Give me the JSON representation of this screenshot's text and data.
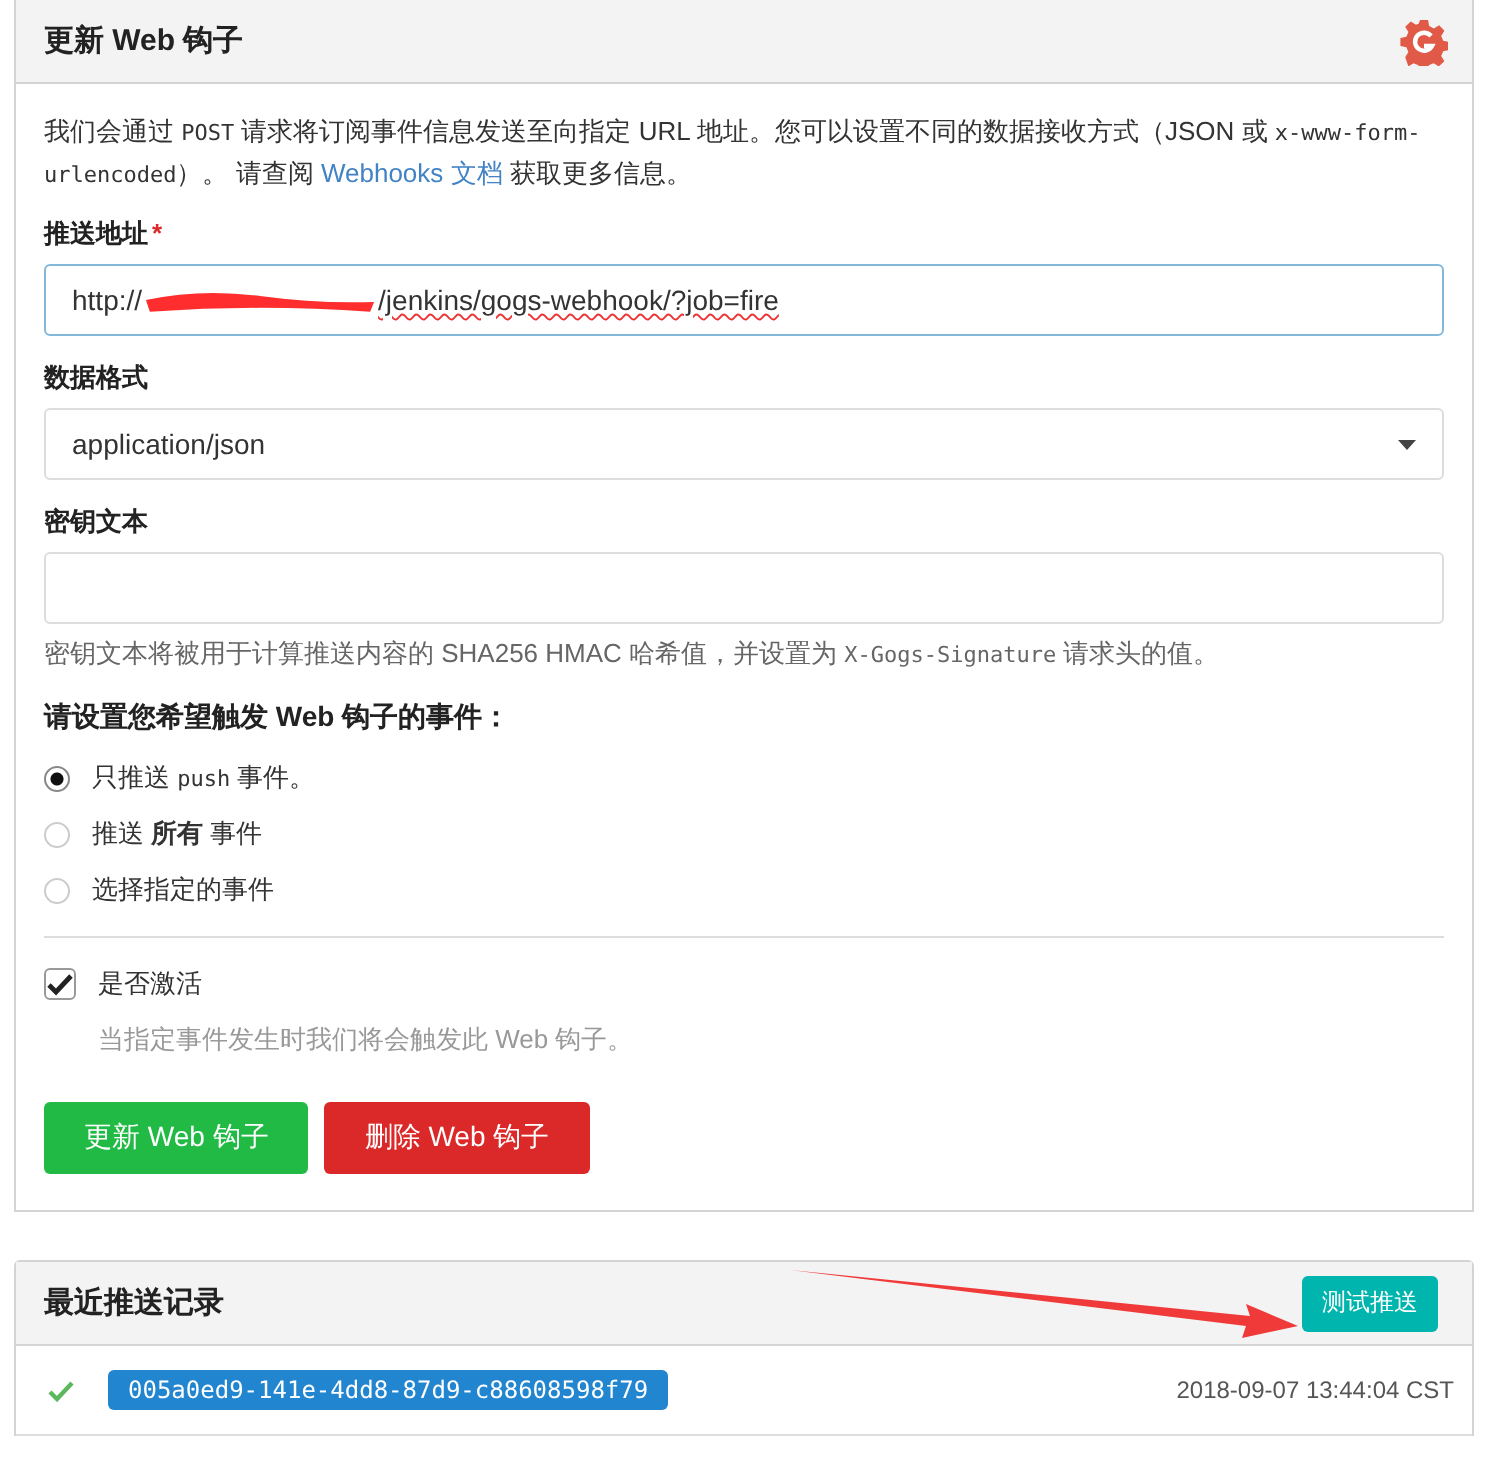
{
  "panel": {
    "title": "更新 Web 钩子",
    "description": [
      {
        "kind": "text",
        "text": "我们会通过 "
      },
      {
        "kind": "code",
        "text": "POST"
      },
      {
        "kind": "text",
        "text": " 请求将订阅事件信息发送至向指定 URL 地址。您可以设置不同的数据接收方式（JSON 或 "
      },
      {
        "kind": "code",
        "text": "x-www-form-urlencoded"
      },
      {
        "kind": "text",
        "text": "）。 请查阅 "
      },
      {
        "kind": "link",
        "text": "Webhooks 文档"
      },
      {
        "kind": "text",
        "text": " 获取更多信息。"
      }
    ],
    "url_field": {
      "label": "推送地址",
      "required_mark": "*",
      "value_start": "http://",
      "value_end": "/jenkins/gogs-webhook/?job=fire",
      "redacted": true
    },
    "format_field": {
      "label": "数据格式",
      "value": "application/json"
    },
    "secret_field": {
      "label": "密钥文本",
      "help": [
        {
          "kind": "text",
          "text": "密钥文本将被用于计算推送内容的 SHA256 HMAC 哈希值，并设置为 "
        },
        {
          "kind": "code",
          "text": "X-Gogs-Signature"
        },
        {
          "kind": "text",
          "text": " 请求头的值。"
        }
      ]
    },
    "events_heading": "请设置您希望触发 Web 钩子的事件：",
    "events": [
      {
        "segments": [
          {
            "kind": "text",
            "text": "只推送 "
          },
          {
            "kind": "code",
            "text": "push"
          },
          {
            "kind": "text",
            "text": " 事件。"
          }
        ],
        "selected": true
      },
      {
        "segments": [
          {
            "kind": "text",
            "text": "推送 **所有** 事件"
          }
        ],
        "selected": false
      },
      {
        "segments": [
          {
            "kind": "text",
            "text": "选择指定的事件"
          }
        ],
        "selected": false
      }
    ],
    "active": {
      "label": "是否激活",
      "checked": true,
      "hint": "当指定事件发生时我们将会触发此 Web 钩子。"
    },
    "buttons": [
      {
        "kind": "primary",
        "label": "更新 Web 钩子"
      },
      {
        "kind": "danger",
        "label": "删除 Web 钩子"
      }
    ]
  },
  "deliveries": {
    "title": "最近推送记录",
    "test_button": "测试推送",
    "rows": [
      {
        "success": true,
        "id": "005a0ed9-141e-4dd8-87d9-c88608598f79",
        "time": "2018-09-07 13:44:04 CST"
      }
    ]
  },
  "annotation": {
    "kind": "arrow"
  }
}
